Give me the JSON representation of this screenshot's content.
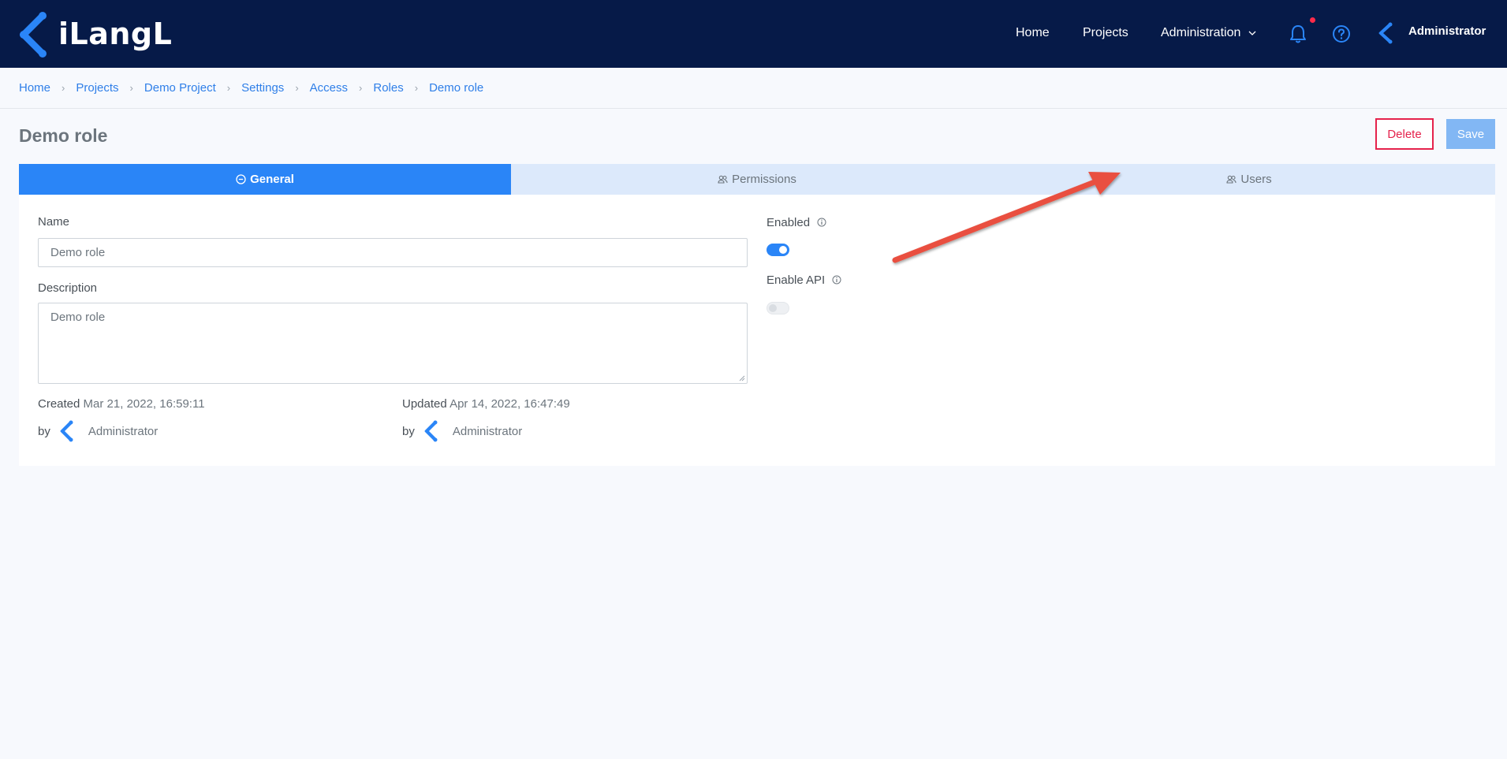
{
  "brand": {
    "name": "iLangL"
  },
  "nav": {
    "home": "Home",
    "projects": "Projects",
    "administration": "Administration",
    "user": "Administrator"
  },
  "breadcrumb": [
    "Home",
    "Projects",
    "Demo Project",
    "Settings",
    "Access",
    "Roles",
    "Demo role"
  ],
  "page": {
    "title": "Demo role",
    "delete_label": "Delete",
    "save_label": "Save"
  },
  "tabs": [
    {
      "label": "General",
      "icon": "minus-circle-icon",
      "active": true
    },
    {
      "label": "Permissions",
      "icon": "users-icon",
      "active": false
    },
    {
      "label": "Users",
      "icon": "users-icon",
      "active": false
    }
  ],
  "form": {
    "name_label": "Name",
    "name_value": "Demo role",
    "description_label": "Description",
    "description_value": "Demo role",
    "enabled_label": "Enabled",
    "enabled": true,
    "enable_api_label": "Enable API",
    "enable_api": false
  },
  "meta": {
    "created_label": "Created",
    "created_value": "Mar 21, 2022, 16:59:11",
    "created_by_label": "by",
    "created_by": "Administrator",
    "updated_label": "Updated",
    "updated_value": "Apr 14, 2022, 16:47:49",
    "updated_by_label": "by",
    "updated_by": "Administrator"
  },
  "colors": {
    "navbar": "#061a48",
    "accent": "#2a85f7",
    "danger": "#e5224c",
    "annotation_arrow": "#e9503f"
  }
}
